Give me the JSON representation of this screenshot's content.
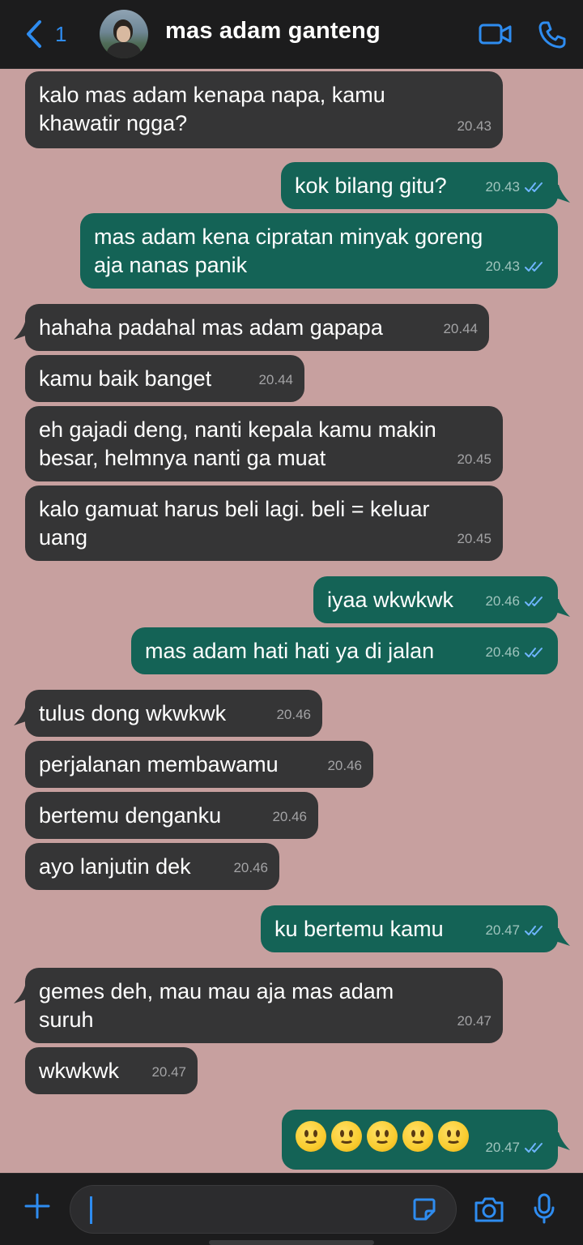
{
  "header": {
    "back_count": "1",
    "contact_name": "mas adam ganteng"
  },
  "messages": [
    {
      "dir": "in",
      "text": "kalo mas adam kenapa napa, kamu\nkhawatir ngga?",
      "time": "20.43"
    },
    {
      "dir": "out",
      "text": "kok bilang gitu?",
      "time": "20.43",
      "status": "read"
    },
    {
      "dir": "out",
      "text": "mas adam kena cipratan minyak goreng\naja nanas panik",
      "time": "20.43",
      "status": "read"
    },
    {
      "dir": "in",
      "text": "hahaha padahal mas adam gapapa",
      "time": "20.44"
    },
    {
      "dir": "in",
      "text": "kamu baik banget",
      "time": "20.44"
    },
    {
      "dir": "in",
      "text": "eh gajadi deng, nanti kepala kamu makin\nbesar, helmnya nanti ga muat",
      "time": "20.45"
    },
    {
      "dir": "in",
      "text": "kalo gamuat harus beli lagi. beli = keluar\nuang",
      "time": "20.45"
    },
    {
      "dir": "out",
      "text": "iyaa wkwkwk",
      "time": "20.46",
      "status": "read"
    },
    {
      "dir": "out",
      "text": "mas adam hati hati ya di jalan",
      "time": "20.46",
      "status": "read"
    },
    {
      "dir": "in",
      "text": "tulus dong wkwkwk",
      "time": "20.46"
    },
    {
      "dir": "in",
      "text": "perjalanan membawamu",
      "time": "20.46"
    },
    {
      "dir": "in",
      "text": "bertemu denganku",
      "time": "20.46"
    },
    {
      "dir": "in",
      "text": "ayo lanjutin dek",
      "time": "20.46"
    },
    {
      "dir": "out",
      "text": "ku bertemu kamu",
      "time": "20.47",
      "status": "read"
    },
    {
      "dir": "in",
      "text": "gemes deh, mau mau aja mas adam\nsuruh",
      "time": "20.47"
    },
    {
      "dir": "in",
      "text": "wkwkwk",
      "time": "20.47"
    },
    {
      "dir": "out",
      "text": "🙂🙂🙂🙂🙂",
      "time": "20.47",
      "status": "read",
      "emoji": "slightly-smiling-face",
      "emoji_count": 5
    }
  ],
  "colors": {
    "chat_background": "#c7a09f",
    "incoming_bubble": "#353536",
    "outgoing_bubble": "#146356",
    "accent": "#2e8cf0"
  },
  "icons": [
    "back-chevron-icon",
    "video-call-icon",
    "phone-icon",
    "plus-icon",
    "sticker-icon",
    "camera-icon",
    "microphone-icon",
    "double-check-icon"
  ]
}
